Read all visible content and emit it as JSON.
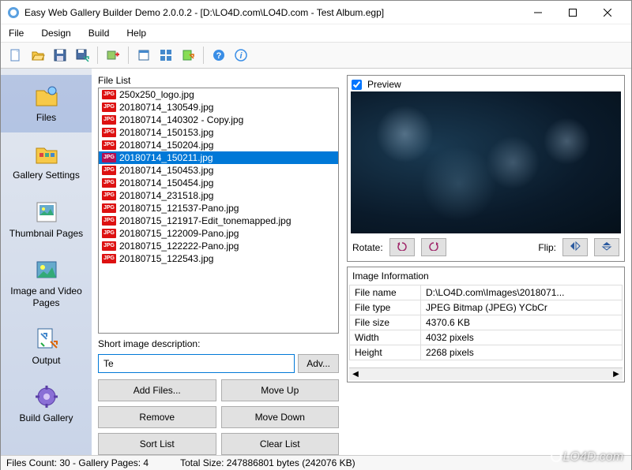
{
  "window": {
    "title": "Easy Web Gallery Builder Demo 2.0.0.2 - [D:\\LO4D.com\\LO4D.com - Test Album.egp]"
  },
  "menu": [
    "File",
    "Design",
    "Build",
    "Help"
  ],
  "sidebar": [
    {
      "label": "Files",
      "selected": true
    },
    {
      "label": "Gallery Settings"
    },
    {
      "label": "Thumbnail Pages"
    },
    {
      "label": "Image and Video Pages"
    },
    {
      "label": "Output"
    },
    {
      "label": "Build Gallery"
    }
  ],
  "file_list": {
    "label": "File List",
    "items": [
      "250x250_logo.jpg",
      "20180714_130549.jpg",
      "20180714_140302 - Copy.jpg",
      "20180714_150153.jpg",
      "20180714_150204.jpg",
      "20180714_150211.jpg",
      "20180714_150453.jpg",
      "20180714_150454.jpg",
      "20180714_231518.jpg",
      "20180715_121537-Pano.jpg",
      "20180715_121917-Edit_tonemapped.jpg",
      "20180715_122009-Pano.jpg",
      "20180715_122222-Pano.jpg",
      "20180715_122543.jpg"
    ],
    "selected_index": 5
  },
  "description": {
    "label": "Short image description:",
    "value": "Te",
    "adv_label": "Adv..."
  },
  "buttons": {
    "add_files": "Add Files...",
    "move_up": "Move Up",
    "remove": "Remove",
    "move_down": "Move Down",
    "sort_list": "Sort List",
    "clear_list": "Clear List"
  },
  "preview": {
    "label": "Preview",
    "checked": true,
    "rotate_label": "Rotate:",
    "flip_label": "Flip:"
  },
  "image_info": {
    "label": "Image Information",
    "rows": [
      [
        "File name",
        "D:\\LO4D.com\\Images\\2018071..."
      ],
      [
        "File type",
        "JPEG Bitmap (JPEG) YCbCr"
      ],
      [
        "File size",
        "4370.6 KB"
      ],
      [
        "Width",
        "4032 pixels"
      ],
      [
        "Height",
        "2268 pixels"
      ]
    ]
  },
  "status": {
    "files": "Files Count: 30 - Gallery Pages: 4",
    "size": "Total Size: 247886801 bytes (242076 KB)"
  },
  "watermark": "LO4D.com"
}
